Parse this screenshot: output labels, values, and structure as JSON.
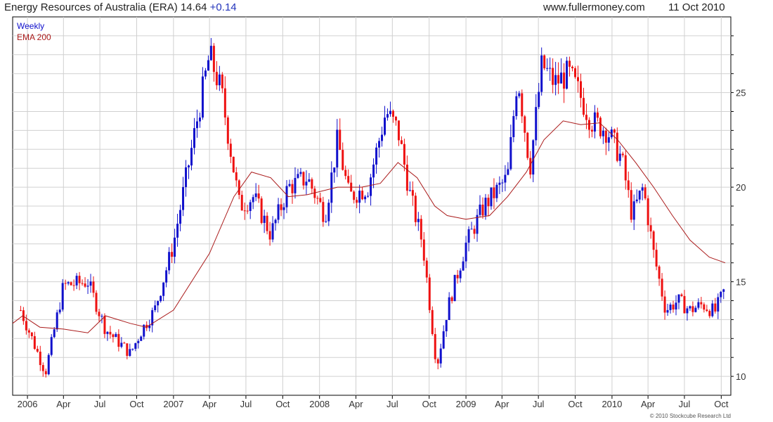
{
  "header": {
    "stock": "Energy Resources of Australia (ERA)",
    "price": "14.64",
    "change": "+0.14",
    "site": "www.fullermoney.com",
    "date": "11 Oct 2010"
  },
  "legend": {
    "weekly": "Weekly",
    "ema": "EMA 200"
  },
  "copyright": "© 2010 Stockcube Research Ltd",
  "colors": {
    "up": "#1010cc",
    "down": "#ee1111",
    "ema": "#aa1a1a",
    "grid": "#d0d0d0",
    "weekly_text": "#1010cc",
    "ema_text": "#aa1a1a"
  },
  "chart_data": {
    "type": "candlestick",
    "title": "Energy Resources of Australia (ERA) 14.64 +0.14",
    "series": [
      {
        "name": "Weekly",
        "x": [
          "2005-12-15",
          "2006-02-15",
          "2006-04-01",
          "2006-06-01",
          "2006-07-15",
          "2006-09-15",
          "2006-10-15",
          "2006-11-15",
          "2007-01-01",
          "2007-02-15",
          "2007-04-01",
          "2007-05-01",
          "2007-06-15",
          "2007-07-20",
          "2007-09-01",
          "2007-10-15",
          "2007-12-01",
          "2008-01-15",
          "2008-02-15",
          "2008-03-15",
          "2008-05-01",
          "2008-06-15",
          "2008-07-15",
          "2008-08-15",
          "2008-09-15",
          "2008-10-20",
          "2008-11-15",
          "2009-01-01",
          "2009-02-15",
          "2009-04-15",
          "2009-05-10",
          "2009-06-10",
          "2009-07-10",
          "2009-08-10",
          "2009-09-15",
          "2009-10-10",
          "2009-11-10",
          "2009-12-20",
          "2010-01-25",
          "2010-02-20",
          "2010-03-20",
          "2010-04-15",
          "2010-05-15",
          "2010-06-15",
          "2010-07-15",
          "2010-08-15",
          "2010-09-15",
          "2010-10-11"
        ],
        "values": [
          13.5,
          10.2,
          14.8,
          15.0,
          12.5,
          11.2,
          12.5,
          13.5,
          17.0,
          22.0,
          27.0,
          25.0,
          19.0,
          19.5,
          17.5,
          20.0,
          20.5,
          18.5,
          22.5,
          19.5,
          20.0,
          24.0,
          23.0,
          19.5,
          17.0,
          10.5,
          13.5,
          17.0,
          19.0,
          20.5,
          26.0,
          21.0,
          26.5,
          25.5,
          26.0,
          25.0,
          23.5,
          23.0,
          21.5,
          18.5,
          20.0,
          16.5,
          13.5,
          14.0,
          13.5,
          13.8,
          13.4,
          14.64
        ]
      },
      {
        "name": "EMA 200",
        "x": [
          "2005-11-25",
          "2005-12-20",
          "2006-02-01",
          "2006-04-01",
          "2006-06-01",
          "2006-07-15",
          "2006-09-15",
          "2006-10-25",
          "2007-01-01",
          "2007-04-01",
          "2007-06-01",
          "2007-07-15",
          "2007-09-01",
          "2007-10-15",
          "2007-12-01",
          "2008-02-15",
          "2008-04-15",
          "2008-06-01",
          "2008-07-15",
          "2008-09-01",
          "2008-10-15",
          "2008-11-15",
          "2009-01-01",
          "2009-03-01",
          "2009-04-15",
          "2009-06-01",
          "2009-07-15",
          "2009-09-01",
          "2009-10-15",
          "2009-12-01",
          "2010-01-15",
          "2010-03-01",
          "2010-04-15",
          "2010-06-01",
          "2010-07-15",
          "2010-09-01",
          "2010-10-11"
        ],
        "values": [
          12.8,
          13.2,
          12.6,
          12.5,
          12.3,
          13.2,
          12.8,
          12.6,
          13.5,
          16.5,
          19.5,
          20.8,
          20.5,
          19.5,
          19.6,
          20.0,
          20.0,
          20.2,
          21.3,
          20.5,
          19.0,
          18.5,
          18.3,
          18.5,
          19.5,
          20.8,
          22.5,
          23.5,
          23.3,
          23.4,
          22.5,
          21.3,
          20.0,
          18.5,
          17.2,
          16.3,
          16.0
        ]
      }
    ],
    "xlabels": [
      "2006",
      "Apr",
      "Jul",
      "Oct",
      "2007",
      "Apr",
      "Jul",
      "Oct",
      "2008",
      "Apr",
      "Jul",
      "Oct",
      "2009",
      "Apr",
      "Jul",
      "Oct",
      "2010",
      "Apr",
      "Jul",
      "Oct"
    ],
    "yticks": [
      10,
      15,
      20,
      25
    ],
    "ylim": [
      9,
      29
    ],
    "xlim": [
      "2005-11-25",
      "2010-10-25"
    ],
    "grid": true,
    "legend_position": "top-left"
  }
}
